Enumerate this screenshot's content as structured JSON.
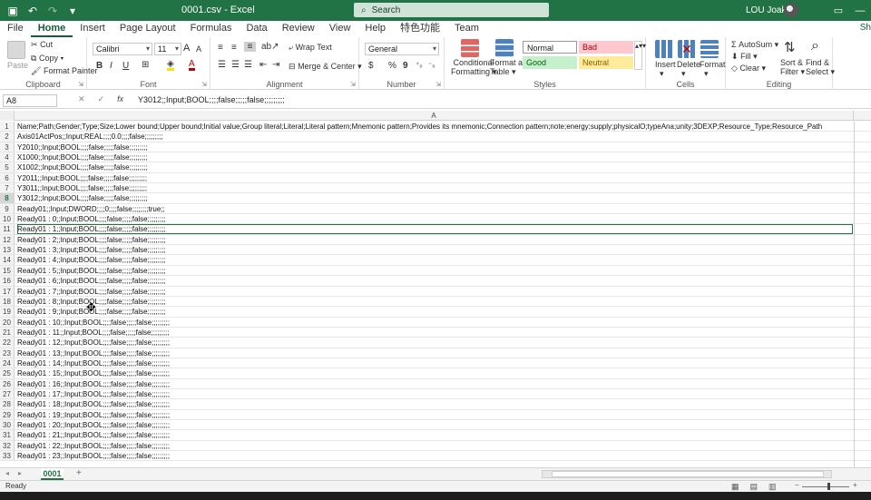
{
  "titlebar": {
    "doc_title": "0001.csv  -  Excel",
    "search_placeholder": "Search",
    "user_name": "LOU Joakim",
    "colors": {
      "bg": "#217346"
    }
  },
  "tabs": [
    "File",
    "Home",
    "Insert",
    "Page Layout",
    "Formulas",
    "Data",
    "Review",
    "View",
    "Help",
    "特色功能",
    "Team"
  ],
  "share_label": "Sh",
  "ribbon": {
    "clipboard": {
      "paste": "Paste",
      "cut": "Cut",
      "copy": "Copy",
      "format_painter": "Format Painter",
      "label": "Clipboard"
    },
    "font": {
      "font_name": "Calibri",
      "font_size": "11",
      "bold": "B",
      "italic": "I",
      "underline": "U",
      "grow": "A",
      "shrink": "A",
      "font_color": "A",
      "label": "Font"
    },
    "alignment": {
      "wrap_text": "Wrap Text",
      "merge_center": "Merge & Center",
      "label": "Alignment"
    },
    "number": {
      "format": "General",
      "currency": "$",
      "percent": "%",
      "comma": "9",
      "label": "Number"
    },
    "styles": {
      "conditional": "Conditional",
      "conditional2": "Formatting",
      "format_table": "Format as",
      "format_table2": "Table",
      "normal": "Normal",
      "bad": "Bad",
      "good": "Good",
      "neutral": "Neutral",
      "label": "Styles"
    },
    "cells": {
      "insert": "Insert",
      "delete": "Delete",
      "format": "Format",
      "label": "Cells"
    },
    "editing": {
      "autosum": "AutoSum",
      "fill": "Fill",
      "clear": "Clear",
      "sort": "Sort &",
      "sort2": "Filter",
      "find": "Find &",
      "find2": "Select",
      "label": "Editing"
    }
  },
  "formula_bar": {
    "name_box": "A8",
    "cancel": "✕",
    "enter": "✓",
    "fx": "fx",
    "content": "Y3012;;Input;BOOL;;;;false;;;;;false;;;;;;;;;"
  },
  "grid": {
    "column_header": "A",
    "rows": [
      {
        "num": "1",
        "text": "Name;Path;Gender;Type;Size;Lower bound;Upper bound;Initial value;Group literal;Literal;Literal pattern;Mnemonic pattern;Provides its mnemonic;Connection pattern;note;energy;supply;physicalO;typeAna;unity;3DEXP;Resource_Type;Resource_Path"
      },
      {
        "num": "2",
        "text": "Axis01ActPos;;Input;REAL;;;;0.0;;;;false;;;;;;;;;"
      },
      {
        "num": "3",
        "text": "Y2010;;Input;BOOL;;;;false;;;;;false;;;;;;;;;"
      },
      {
        "num": "4",
        "text": "X1000;;Input;BOOL;;;;false;;;;;false;;;;;;;;;"
      },
      {
        "num": "5",
        "text": "X1002;;Input;BOOL;;;;false;;;;;false;;;;;;;;;"
      },
      {
        "num": "6",
        "text": "Y2011;;Input;BOOL;;;;false;;;;;false;;;;;;;;;"
      },
      {
        "num": "7",
        "text": "Y3011;;Input;BOOL;;;;false;;;;;false;;;;;;;;;"
      },
      {
        "num": "8",
        "text": "Y3012;;Input;BOOL;;;;false;;;;;false;;;;;;;;;"
      },
      {
        "num": "9",
        "text": "Ready01;;Input;DWORD;;;;0;;;;false;;;;;;;;true;;"
      },
      {
        "num": "10",
        "text": "Ready01 : 0;;Input;BOOL;;;;false;;;;;false;;;;;;;;;"
      },
      {
        "num": "11",
        "text": "Ready01 : 1;;Input;BOOL;;;;false;;;;;false;;;;;;;;;"
      },
      {
        "num": "12",
        "text": "Ready01 : 2;;Input;BOOL;;;;false;;;;;false;;;;;;;;;"
      },
      {
        "num": "13",
        "text": "Ready01 : 3;;Input;BOOL;;;;false;;;;;false;;;;;;;;;"
      },
      {
        "num": "14",
        "text": "Ready01 : 4;;Input;BOOL;;;;false;;;;;false;;;;;;;;;"
      },
      {
        "num": "15",
        "text": "Ready01 : 5;;Input;BOOL;;;;false;;;;;false;;;;;;;;;"
      },
      {
        "num": "16",
        "text": "Ready01 : 6;;Input;BOOL;;;;false;;;;;false;;;;;;;;;"
      },
      {
        "num": "17",
        "text": "Ready01 : 7;;Input;BOOL;;;;false;;;;;false;;;;;;;;;"
      },
      {
        "num": "18",
        "text": "Ready01 : 8;;Input;BOOL;;;;false;;;;;false;;;;;;;;;"
      },
      {
        "num": "19",
        "text": "Ready01 : 9;;Input;BOOL;;;;false;;;;;false;;;;;;;;;"
      },
      {
        "num": "20",
        "text": "Ready01 : 10;;Input;BOOL;;;;false;;;;;false;;;;;;;;;"
      },
      {
        "num": "21",
        "text": "Ready01 : 11;;Input;BOOL;;;;false;;;;;false;;;;;;;;;"
      },
      {
        "num": "22",
        "text": "Ready01 : 12;;Input;BOOL;;;;false;;;;;false;;;;;;;;;"
      },
      {
        "num": "23",
        "text": "Ready01 : 13;;Input;BOOL;;;;false;;;;;false;;;;;;;;;"
      },
      {
        "num": "24",
        "text": "Ready01 : 14;;Input;BOOL;;;;false;;;;;false;;;;;;;;;"
      },
      {
        "num": "25",
        "text": "Ready01 : 15;;Input;BOOL;;;;false;;;;;false;;;;;;;;;"
      },
      {
        "num": "26",
        "text": "Ready01 : 16;;Input;BOOL;;;;false;;;;;false;;;;;;;;;"
      },
      {
        "num": "27",
        "text": "Ready01 : 17;;Input;BOOL;;;;false;;;;;false;;;;;;;;;"
      },
      {
        "num": "28",
        "text": "Ready01 : 18;;Input;BOOL;;;;false;;;;;false;;;;;;;;;"
      },
      {
        "num": "29",
        "text": "Ready01 : 19;;Input;BOOL;;;;false;;;;;false;;;;;;;;;"
      },
      {
        "num": "30",
        "text": "Ready01 : 20;;Input;BOOL;;;;false;;;;;false;;;;;;;;;"
      },
      {
        "num": "31",
        "text": "Ready01 : 21;;Input;BOOL;;;;false;;;;;false;;;;;;;;;"
      },
      {
        "num": "32",
        "text": "Ready01 : 22;;Input;BOOL;;;;false;;;;;false;;;;;;;;;"
      },
      {
        "num": "33",
        "text": "Ready01 : 23;;Input;BOOL;;;;false;;;;;false;;;;;;;;;"
      }
    ],
    "selected_row": "8",
    "outlined_row": "11"
  },
  "sheets": {
    "active": "0001",
    "add": "+"
  },
  "status": {
    "text": "Ready"
  }
}
